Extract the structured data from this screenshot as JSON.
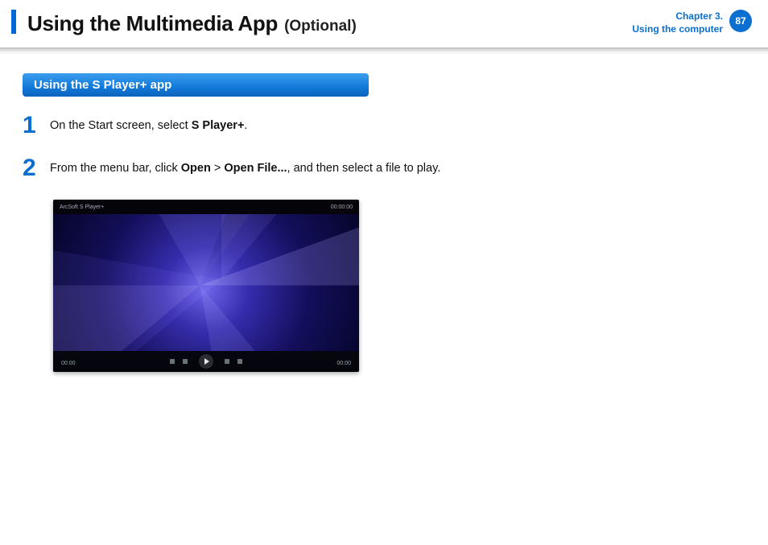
{
  "header": {
    "title": "Using the Multimedia App",
    "subtitle": "(Optional)",
    "chapter_line1": "Chapter 3.",
    "chapter_line2": "Using the computer",
    "page_number": "87"
  },
  "section": {
    "title": "Using the S Player+ app"
  },
  "steps": {
    "s1": {
      "num": "1",
      "pre": "On the Start screen, select ",
      "bold": "S Player+",
      "post": "."
    },
    "s2": {
      "num": "2",
      "pre": "From the menu bar, click ",
      "bold1": "Open",
      "mid": " > ",
      "bold2": "Open File...",
      "post": ", and then select a file to play."
    }
  },
  "player": {
    "top_left": "ArcSoft S Player+",
    "top_right": "00:00:00",
    "time_left": "00:00",
    "time_right": "00:00"
  }
}
